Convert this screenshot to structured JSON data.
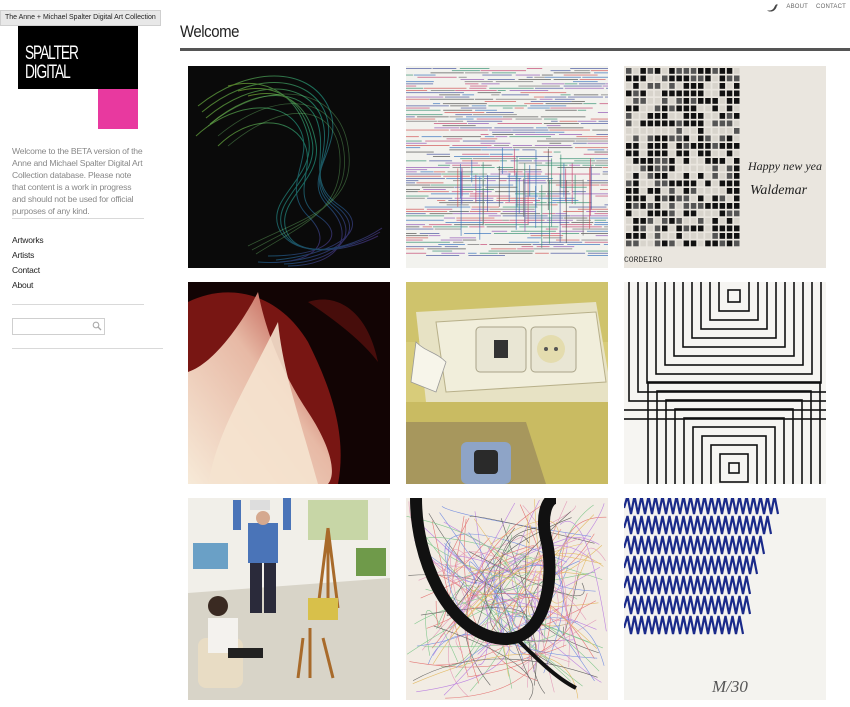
{
  "tooltip": "The Anne + Michael Spalter Digital Art Collection",
  "logo": {
    "line1": "SPALTER",
    "line2": "DIGITAL",
    "accent_color": "#e8399f"
  },
  "intro": "Welcome to the BETA version of the Anne and Michael Spalter Digital Art Collection database. Please note that content is a work in progress and should not be used for official purposes of any kind.",
  "nav": {
    "items": [
      "Artworks",
      "Artists",
      "Contact",
      "About"
    ]
  },
  "search": {
    "placeholder": "",
    "value": ""
  },
  "top_links": {
    "twitter_icon": "twitter-bird-icon",
    "about": "ABOUT",
    "contact": "CONTACT"
  },
  "page": {
    "title": "Welcome"
  },
  "artworks": {
    "tile3": {
      "caption": "Happy new yea",
      "signature": "Waldemar",
      "artist_mark": "CORDEIRO"
    },
    "tile9": {
      "signature": "M/30"
    }
  }
}
